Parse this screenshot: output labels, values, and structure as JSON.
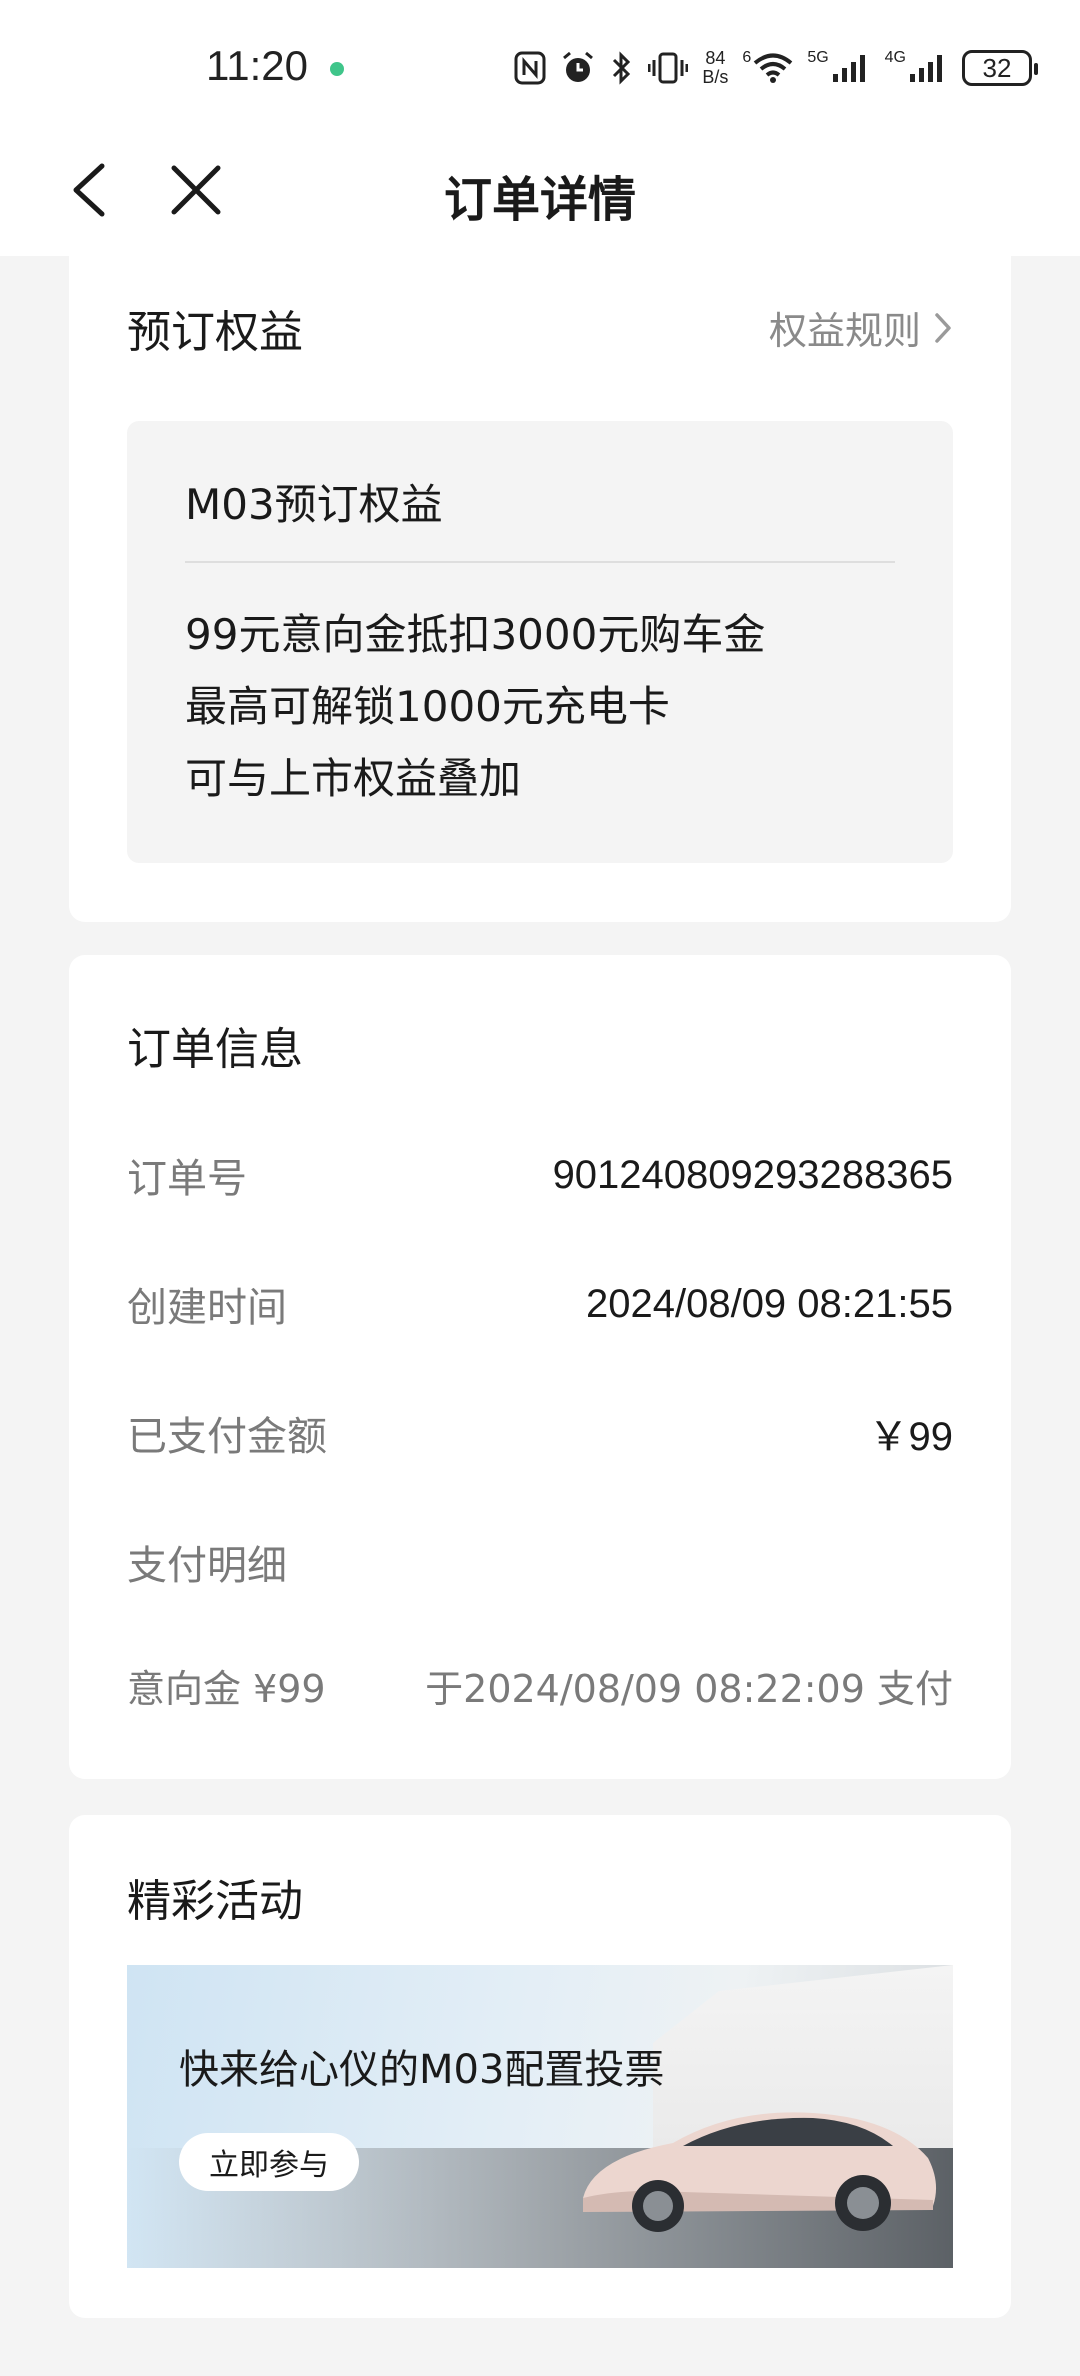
{
  "status_bar": {
    "time": "11:20",
    "net_speed_value": "84",
    "net_speed_unit": "B/s",
    "wifi_label": "6",
    "sim1_label": "5G",
    "sim2_label": "4G",
    "battery": "32"
  },
  "nav": {
    "title": "订单详情"
  },
  "benefits": {
    "title": "预订权益",
    "rules_link": "权益规则",
    "box_title": "M03预订权益",
    "lines": [
      "99元意向金抵扣3000元购车金",
      "最高可解锁1000元充电卡",
      "可与上市权益叠加"
    ]
  },
  "order_info": {
    "title": "订单信息",
    "rows": [
      {
        "label": "订单号",
        "value": "901240809293288365"
      },
      {
        "label": "创建时间",
        "value": "2024/08/09 08:21:55"
      },
      {
        "label": "已支付金额",
        "value": "￥99"
      }
    ],
    "pay_detail_label": "支付明细",
    "pay_detail_item": "意向金 ¥99",
    "pay_detail_time": "于2024/08/09 08:22:09 支付"
  },
  "activities": {
    "title": "精彩活动",
    "banner_text": "快来给心仪的M03配置投票",
    "banner_button": "立即参与"
  },
  "colors": {
    "background": "#f4f4f4",
    "card": "#ffffff",
    "text_primary": "#1a1a1a",
    "text_secondary": "#7a7a7a"
  }
}
